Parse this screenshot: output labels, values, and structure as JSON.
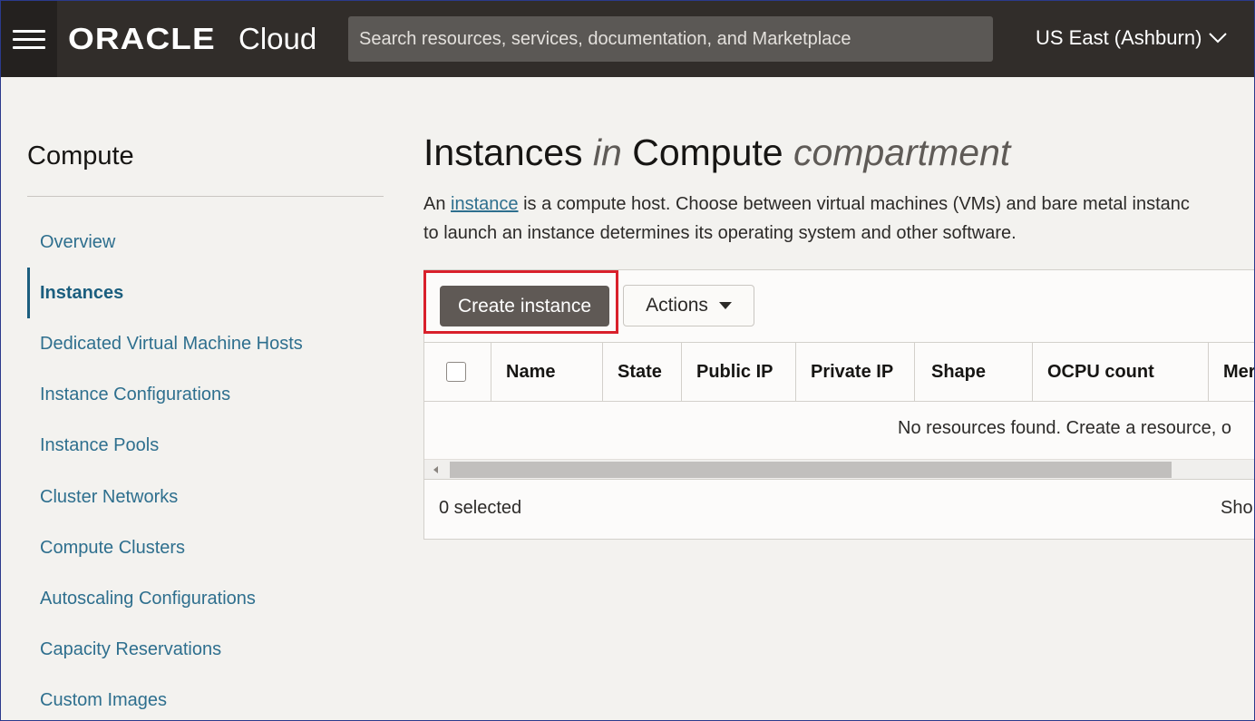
{
  "header": {
    "brand_oracle": "ORACLE",
    "brand_cloud": "Cloud",
    "search_placeholder": "Search resources, services, documentation, and Marketplace",
    "region": "US East (Ashburn)"
  },
  "sidebar": {
    "title": "Compute",
    "items": [
      {
        "label": "Overview",
        "active": false
      },
      {
        "label": "Instances",
        "active": true
      },
      {
        "label": "Dedicated Virtual Machine Hosts",
        "active": false
      },
      {
        "label": "Instance Configurations",
        "active": false
      },
      {
        "label": "Instance Pools",
        "active": false
      },
      {
        "label": "Cluster Networks",
        "active": false
      },
      {
        "label": "Compute Clusters",
        "active": false
      },
      {
        "label": "Autoscaling Configurations",
        "active": false
      },
      {
        "label": "Capacity Reservations",
        "active": false
      },
      {
        "label": "Custom Images",
        "active": false
      }
    ]
  },
  "main": {
    "title_part1": "Instances",
    "title_in": "in",
    "title_part2": "Compute",
    "title_compartment": "compartment",
    "desc_prefix": "An ",
    "desc_link": "instance",
    "desc_line1_rest": " is a compute host. Choose between virtual machines (VMs) and bare metal instanc",
    "desc_line2": "to launch an instance determines its operating system and other software.",
    "create_button": "Create instance",
    "actions_button": "Actions",
    "table": {
      "columns": [
        "Name",
        "State",
        "Public IP",
        "Private IP",
        "Shape",
        "OCPU count",
        "Mer"
      ],
      "empty_message": "No resources found. Create a resource, o"
    },
    "footer_selected": "0 selected",
    "footer_show": "Sho"
  },
  "colors": {
    "header_bg": "#312d2a",
    "link": "#2e6f8e",
    "primary_button": "#5f5955",
    "highlight": "#d9202b"
  }
}
